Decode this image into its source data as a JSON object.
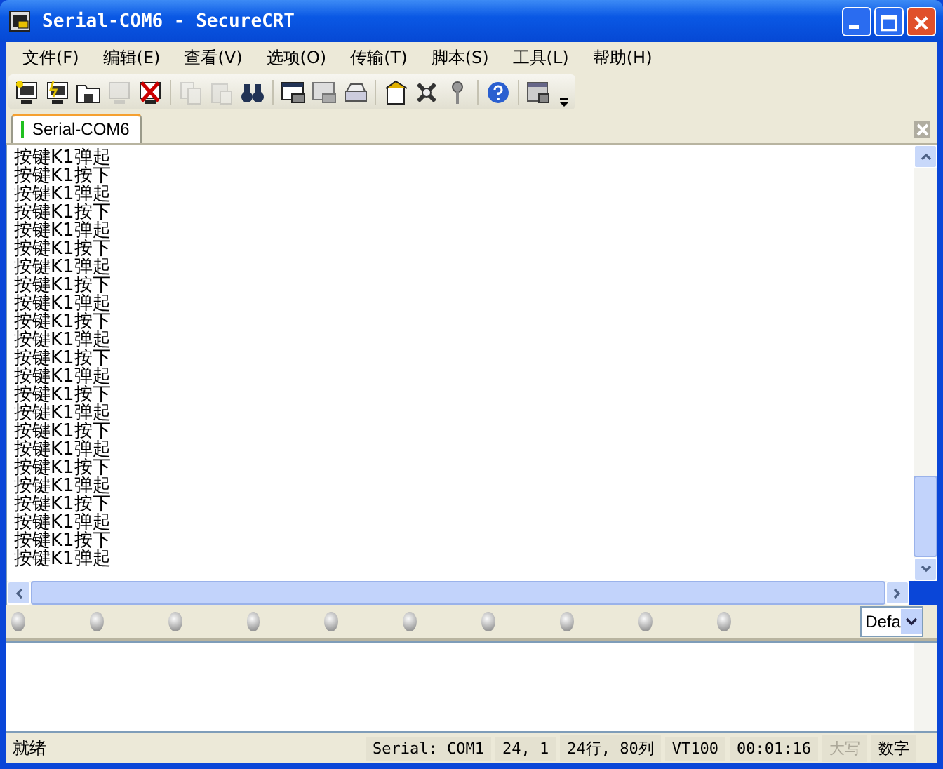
{
  "window": {
    "title": "Serial-COM6 - SecureCRT"
  },
  "menu": [
    "文件(F)",
    "编辑(E)",
    "查看(V)",
    "选项(O)",
    "传输(T)",
    "脚本(S)",
    "工具(L)",
    "帮助(H)"
  ],
  "toolbar": [
    {
      "kind": "connect",
      "disabled": false
    },
    {
      "kind": "quick",
      "disabled": false
    },
    {
      "kind": "tab",
      "disabled": false
    },
    {
      "kind": "reconnect",
      "disabled": true
    },
    {
      "kind": "disconnect",
      "disabled": false
    },
    {
      "kind": "separator"
    },
    {
      "kind": "copy",
      "disabled": true
    },
    {
      "kind": "paste",
      "disabled": true
    },
    {
      "kind": "find",
      "disabled": false
    },
    {
      "kind": "separator"
    },
    {
      "kind": "printsetup",
      "disabled": false
    },
    {
      "kind": "printsel",
      "disabled": false
    },
    {
      "kind": "print",
      "disabled": false
    },
    {
      "kind": "separator"
    },
    {
      "kind": "options",
      "disabled": false
    },
    {
      "kind": "global",
      "disabled": false
    },
    {
      "kind": "key",
      "disabled": false
    },
    {
      "kind": "separator"
    },
    {
      "kind": "help",
      "disabled": false
    },
    {
      "kind": "separator"
    },
    {
      "kind": "lock",
      "disabled": false
    }
  ],
  "tabs": [
    {
      "label": "Serial-COM6",
      "selected": true,
      "connected": true
    }
  ],
  "terminal": {
    "lines": [
      "按键K1弹起",
      "按键K1按下",
      "按键K1弹起",
      "按键K1按下",
      "按键K1弹起",
      "按键K1按下",
      "按键K1弹起",
      "按键K1按下",
      "按键K1弹起",
      "按键K1按下",
      "按键K1弹起",
      "按键K1按下",
      "按键K1弹起",
      "按键K1按下",
      "按键K1弹起",
      "按键K1按下",
      "按键K1弹起",
      "按键K1按下",
      "按键K1弹起",
      "按键K1按下",
      "按键K1弹起",
      "按键K1按下",
      "按键K1弹起"
    ]
  },
  "button_bar": {
    "buttons": [
      {
        "kind": "orb"
      },
      {
        "kind": "orb"
      },
      {
        "kind": "orb"
      },
      {
        "kind": "orb"
      },
      {
        "kind": "orb"
      },
      {
        "kind": "orb"
      },
      {
        "kind": "orb"
      },
      {
        "kind": "orb"
      },
      {
        "kind": "orb"
      },
      {
        "kind": "orb"
      }
    ],
    "combo": "Defa"
  },
  "status_bar": [
    {
      "text": "就绪",
      "disabled": false
    },
    {
      "text": "Serial: COM1",
      "disabled": false
    },
    {
      "text": "24,   1",
      "disabled": false
    },
    {
      "text": "24行, 80列",
      "disabled": false
    },
    {
      "text": "VT100",
      "disabled": false
    },
    {
      "text": "00:01:16",
      "disabled": false
    },
    {
      "text": "大写",
      "disabled": true
    },
    {
      "text": "数字",
      "disabled": false
    }
  ]
}
